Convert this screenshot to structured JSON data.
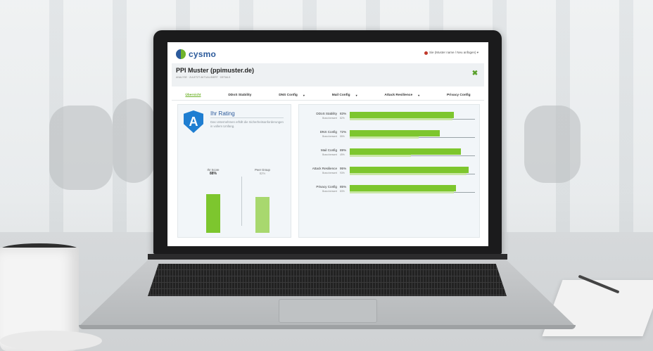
{
  "app": {
    "logo_text": "cysmo",
    "user_menu_label": "Sie (Muster name / Neu anfügen) ▾"
  },
  "header": {
    "title": "PPI Muster (ppimuster.de)",
    "subtitle": "ANALYSE · ZULETZT AKTUALISIERT · DETAILS",
    "export_icon": "excel-icon"
  },
  "tabs": [
    {
      "label": "Übersicht",
      "active": true
    },
    {
      "label": "DDoS Stability",
      "active": false
    },
    {
      "label": "DNS Config",
      "active": false,
      "has_caret": true
    },
    {
      "label": "Mail Config",
      "active": false,
      "has_caret": true
    },
    {
      "label": "Attack Resilience",
      "active": false,
      "has_caret": true
    },
    {
      "label": "Privacy Config",
      "active": false
    }
  ],
  "rating": {
    "grade": "A",
    "title": "Ihr Rating",
    "description": "Das Unternehmen erfüllt die Sicherheitsanforderungen in vollem Umfang.",
    "your_score_label": "Ihr Score",
    "your_score_value": "88%",
    "your_score_fraction": 0.88,
    "peer_label": "Peer Group",
    "peer_value": "82%",
    "peer_fraction": 0.82
  },
  "categories": [
    {
      "name": "DDoS Stability",
      "sub": "Branchenwert",
      "value": "83%",
      "sub_value": "82%",
      "fraction": 0.83,
      "sub_fraction": 0.82
    },
    {
      "name": "DNS Config",
      "sub": "Branchenwert",
      "value": "72%",
      "sub_value": "55%",
      "fraction": 0.72,
      "sub_fraction": 0.55
    },
    {
      "name": "Mail Config",
      "sub": "Branchenwert",
      "value": "89%",
      "sub_value": "49%",
      "fraction": 0.89,
      "sub_fraction": 0.49
    },
    {
      "name": "Attack Resilience",
      "sub": "Branchenwert",
      "value": "95%",
      "sub_value": "93%",
      "fraction": 0.95,
      "sub_fraction": 0.93
    },
    {
      "name": "Privacy Config",
      "sub": "Branchenwert",
      "value": "85%",
      "sub_value": "83%",
      "fraction": 0.85,
      "sub_fraction": 0.83
    }
  ],
  "colors": {
    "accent_green": "#7dc62e",
    "light_green": "#c9e6a6",
    "brand_blue": "#2b5a9b",
    "shield_blue": "#1f7ed1"
  }
}
